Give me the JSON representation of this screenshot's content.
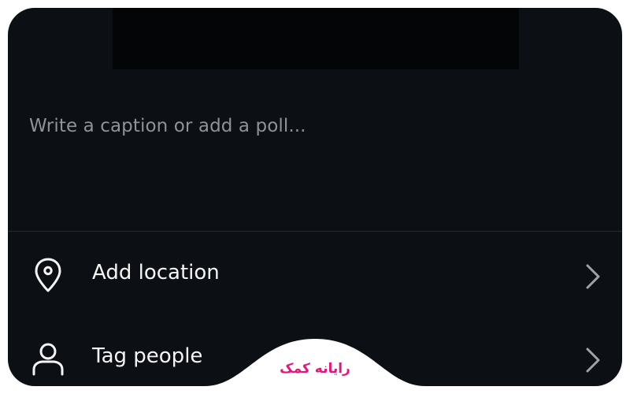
{
  "composer": {
    "caption_placeholder": "Write a caption or add a poll..."
  },
  "options": [
    {
      "label": "Add location",
      "icon": "location-pin-icon"
    },
    {
      "label": "Tag people",
      "icon": "person-icon"
    }
  ],
  "watermark": {
    "text": "رایانه کمک",
    "color": "#e8147a"
  },
  "colors": {
    "background": "#0c1014",
    "text_primary": "#f5f5f5",
    "text_placeholder": "#8e9397"
  }
}
